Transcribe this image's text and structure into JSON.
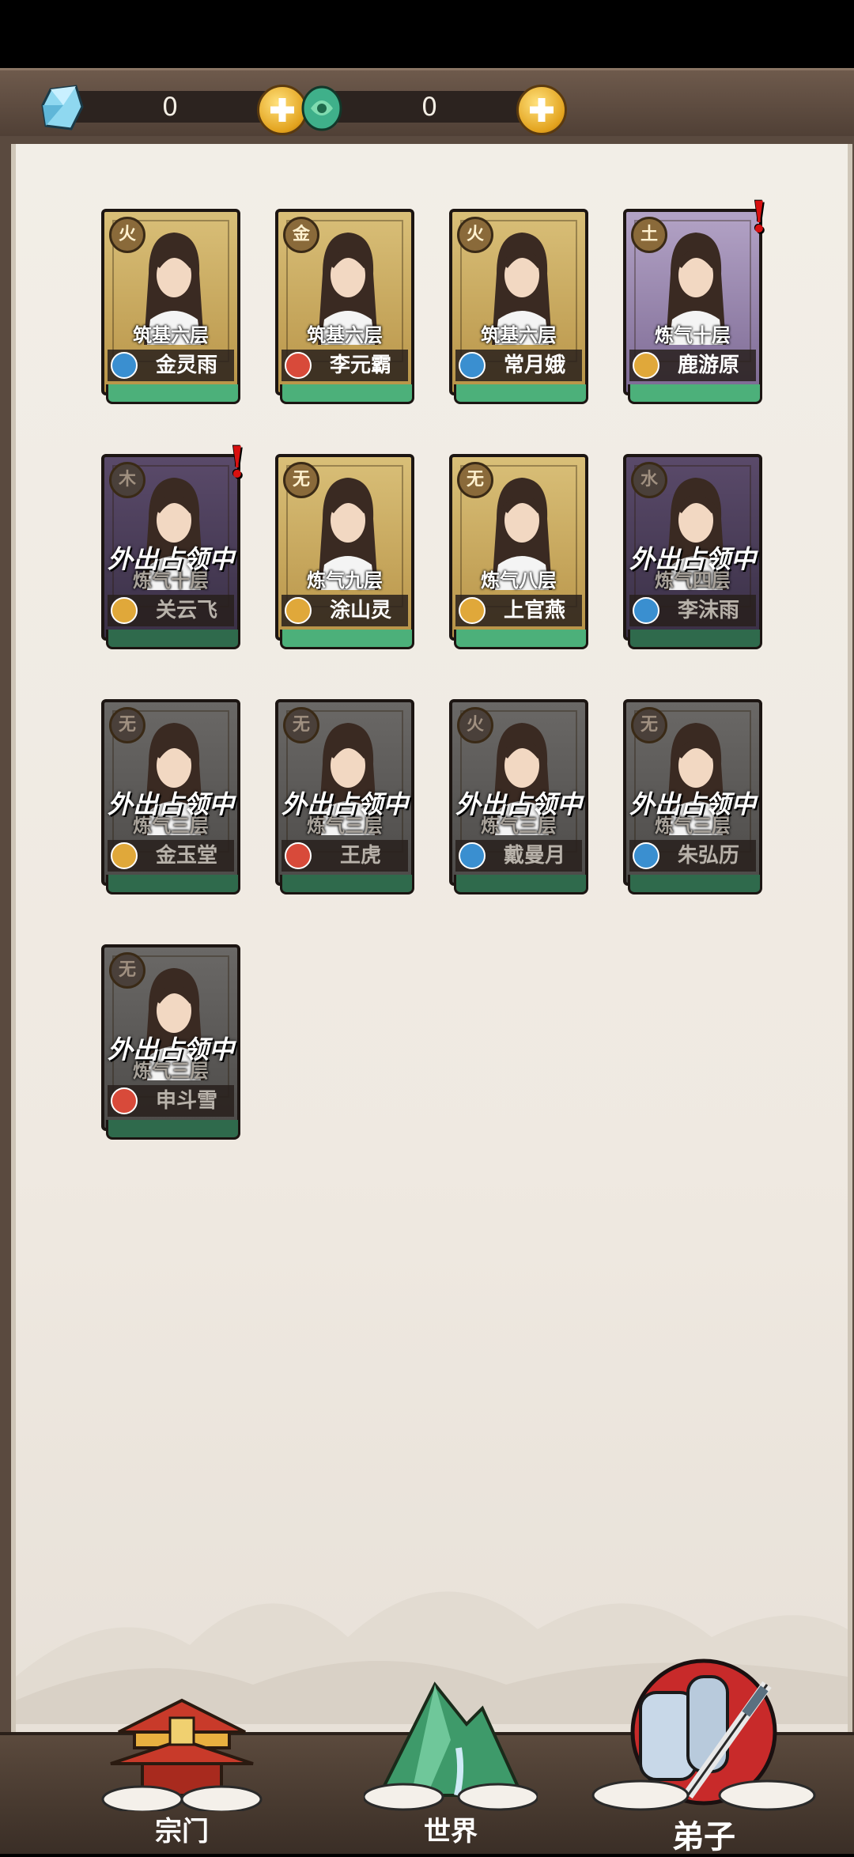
{
  "resources": [
    {
      "name": "spirit-stone",
      "value": "0",
      "color": "#6fc7e8"
    },
    {
      "name": "jade",
      "value": "0",
      "color": "#3fb08a"
    }
  ],
  "status_away": "外出占领中",
  "disciples": [
    {
      "name": "金灵雨",
      "rank": "筑基六层",
      "element": "火",
      "tier": "gold",
      "sect": "water",
      "away": false,
      "alert": false
    },
    {
      "name": "李元霸",
      "rank": "筑基六层",
      "element": "金",
      "tier": "gold",
      "sect": "fire",
      "away": false,
      "alert": false
    },
    {
      "name": "常月娥",
      "rank": "筑基六层",
      "element": "火",
      "tier": "gold",
      "sect": "water",
      "away": false,
      "alert": false
    },
    {
      "name": "鹿游原",
      "rank": "炼气十层",
      "element": "土",
      "tier": "purple",
      "sect": "earth",
      "away": false,
      "alert": true
    },
    {
      "name": "关云飞",
      "rank": "炼气十层",
      "element": "木",
      "tier": "dpurple",
      "sect": "earth",
      "away": true,
      "alert": true
    },
    {
      "name": "涂山灵",
      "rank": "炼气九层",
      "element": "无",
      "tier": "gold",
      "sect": "earth",
      "away": false,
      "alert": false
    },
    {
      "name": "上官燕",
      "rank": "炼气八层",
      "element": "无",
      "tier": "gold",
      "sect": "earth",
      "away": false,
      "alert": false
    },
    {
      "name": "李沫雨",
      "rank": "炼气四层",
      "element": "水",
      "tier": "dpurple",
      "sect": "water",
      "away": true,
      "alert": false
    },
    {
      "name": "金玉堂",
      "rank": "炼气三层",
      "element": "无",
      "tier": "gray",
      "sect": "earth",
      "away": true,
      "alert": false
    },
    {
      "name": "王虎",
      "rank": "炼气三层",
      "element": "无",
      "tier": "gray",
      "sect": "fire",
      "away": true,
      "alert": false
    },
    {
      "name": "戴曼月",
      "rank": "炼气三层",
      "element": "火",
      "tier": "gray",
      "sect": "water",
      "away": true,
      "alert": false
    },
    {
      "name": "朱弘历",
      "rank": "炼气三层",
      "element": "无",
      "tier": "gray",
      "sect": "water",
      "away": true,
      "alert": false
    },
    {
      "name": "申斗雪",
      "rank": "炼气三层",
      "element": "无",
      "tier": "gray",
      "sect": "fire",
      "away": true,
      "alert": false
    }
  ],
  "nav": [
    {
      "label": "宗门",
      "icon": "sect-temple-icon",
      "active": false
    },
    {
      "label": "世界",
      "icon": "mountain-icon",
      "active": false
    },
    {
      "label": "弟子",
      "icon": "scroll-sword-icon",
      "active": true
    }
  ],
  "colors": {
    "sect_water": "#3a8fd0",
    "sect_fire": "#d84a3a",
    "sect_earth": "#e0a83a"
  }
}
